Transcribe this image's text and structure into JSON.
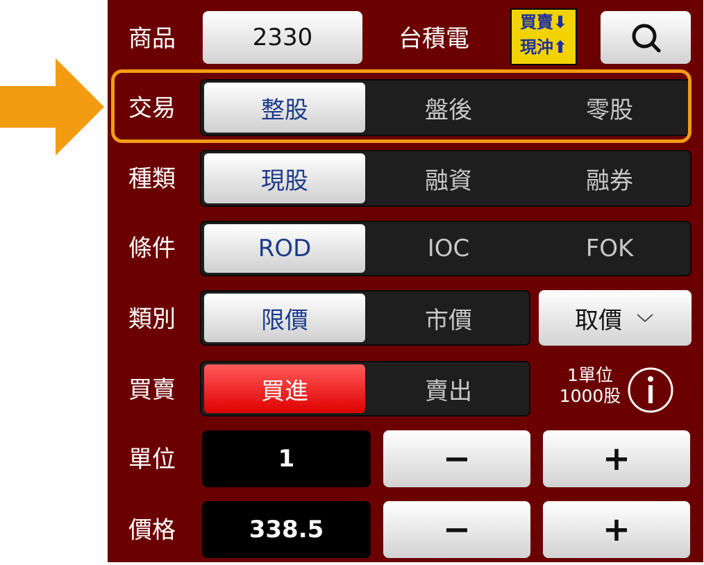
{
  "product": {
    "label": "商品",
    "code": "2330",
    "name": "台積電",
    "badge_line1": "買賣",
    "badge_line2": "現沖"
  },
  "trade": {
    "label": "交易",
    "options": [
      "整股",
      "盤後",
      "零股"
    ],
    "selected": 0
  },
  "kind": {
    "label": "種類",
    "options": [
      "現股",
      "融資",
      "融券"
    ],
    "selected": 0
  },
  "condition": {
    "label": "條件",
    "options": [
      "ROD",
      "IOC",
      "FOK"
    ],
    "selected": 0
  },
  "category": {
    "label": "類別",
    "options": [
      "限價",
      "市價"
    ],
    "selected": 0,
    "take_price": "取價"
  },
  "side": {
    "label": "買賣",
    "options": [
      "買進",
      "賣出"
    ],
    "selected": 0,
    "unit_line1": "1單位",
    "unit_line2": "1000股"
  },
  "unit": {
    "label": "單位",
    "value": "1",
    "minus": "−",
    "plus": "+"
  },
  "price": {
    "label": "價格",
    "value": "338.5",
    "minus": "−",
    "plus": "+"
  },
  "colors": {
    "panel": "#6b0000",
    "highlight": "#f39c12",
    "arrow": "#f39c12",
    "selected_text": "#1d3b8a",
    "buy": "#e00000"
  },
  "icons": [
    "search-icon",
    "chevron-down-icon",
    "info-icon",
    "arrow-right-icon"
  ]
}
